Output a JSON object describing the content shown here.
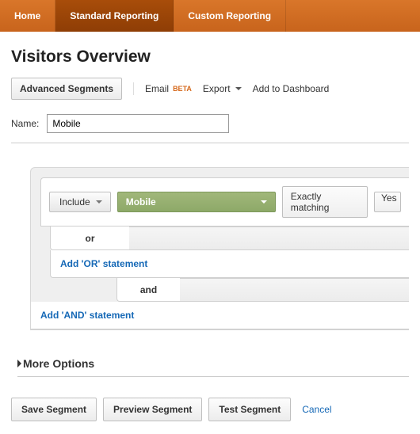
{
  "nav": {
    "tabs": [
      {
        "label": "Home",
        "active": false
      },
      {
        "label": "Standard Reporting",
        "active": true
      },
      {
        "label": "Custom Reporting",
        "active": false
      }
    ]
  },
  "page": {
    "title": "Visitors Overview"
  },
  "toolbar": {
    "advanced_segments": "Advanced Segments",
    "email": "Email",
    "beta": "BETA",
    "export": "Export",
    "add_to_dashboard": "Add to Dashboard"
  },
  "form": {
    "name_label": "Name:",
    "name_value": "Mobile"
  },
  "builder": {
    "include_label": "Include",
    "dimension": "Mobile",
    "match_type": "Exactly matching",
    "value": "Yes",
    "or_label": "or",
    "add_or": "Add 'OR' statement",
    "and_label": "and",
    "add_and": "Add 'AND' statement"
  },
  "more_options": "More Options",
  "footer": {
    "save": "Save Segment",
    "preview": "Preview Segment",
    "test": "Test Segment",
    "cancel": "Cancel"
  }
}
